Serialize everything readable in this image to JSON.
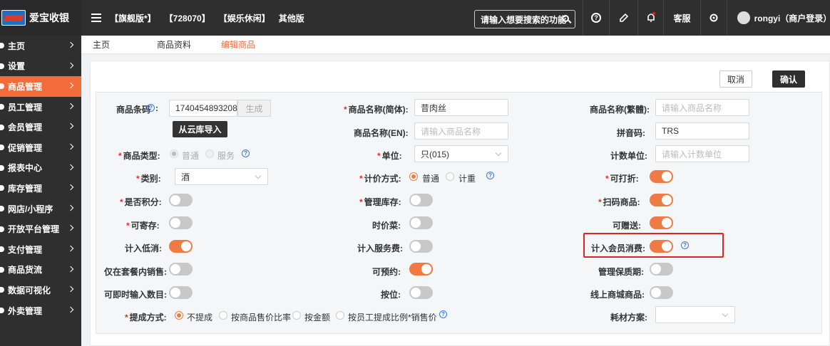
{
  "app": {
    "name": "爱宝收银"
  },
  "header": {
    "tags": [
      "【旗舰版*】",
      "【728070】",
      "【娱乐休闲】",
      "其他版"
    ],
    "search_placeholder": "请输入想要搜索的功能",
    "message_label": "客服",
    "user_label": "rongyi（商户登录）"
  },
  "sidebar": {
    "items": [
      {
        "label": "主页"
      },
      {
        "label": "设置"
      },
      {
        "label": "商品管理"
      },
      {
        "label": "员工管理"
      },
      {
        "label": "会员管理"
      },
      {
        "label": "促销管理"
      },
      {
        "label": "报表中心"
      },
      {
        "label": "库存管理"
      },
      {
        "label": "网店/小程序"
      },
      {
        "label": "开放平台管理"
      },
      {
        "label": "支付管理"
      },
      {
        "label": "商品货流"
      },
      {
        "label": "数据可视化"
      },
      {
        "label": "外卖管理"
      }
    ],
    "active_index": 2
  },
  "tabs": [
    "主页",
    "商品资料",
    "编辑商品"
  ],
  "actions": {
    "cancel": "取消",
    "confirm": "确认"
  },
  "form": {
    "barcode": {
      "label": "商品条码",
      "value": "1740454893208",
      "generate": "生成",
      "import": "从云库导入"
    },
    "name_simplified": {
      "label": "商品名称(简体):",
      "value": "昔肉丝"
    },
    "name_traditional": {
      "label": "商品名称(繁體):",
      "placeholder": "请输入商品名称"
    },
    "name_en": {
      "label": "商品名称(EN):",
      "placeholder": "请输入商品名称"
    },
    "pinyin": {
      "label": "拼音码:",
      "value": "TRS"
    },
    "product_type": {
      "label": "商品类型:",
      "options": [
        "普通",
        "服务"
      ]
    },
    "unit": {
      "label": "单位:",
      "value": "只(015)"
    },
    "count_unit": {
      "label": "计数单位:",
      "placeholder": "请输入计数单位"
    },
    "category": {
      "label": "类别:",
      "value": "酒"
    },
    "pricing": {
      "label": "计价方式:",
      "options": [
        "普通",
        "计重"
      ]
    },
    "discountable": {
      "label": "可打折:",
      "on": true
    },
    "points": {
      "label": "是否积分:",
      "on": false
    },
    "manage_stock": {
      "label": "管理库存:",
      "on": false
    },
    "scan": {
      "label": "扫码商品:",
      "on": true
    },
    "storable": {
      "label": "可寄存:",
      "on": false
    },
    "seasonal": {
      "label": "时价菜:",
      "on": false
    },
    "giftable": {
      "label": "可赠送:",
      "on": true
    },
    "min_spend": {
      "label": "计入低消:",
      "on": true
    },
    "service_fee": {
      "label": "计入服务费:",
      "on": false
    },
    "member_spend": {
      "label": "计入会员消费:",
      "on": true
    },
    "package_only": {
      "label": "仅在套餐内销售:",
      "on": false
    },
    "reservable": {
      "label": "可预约:",
      "on": true
    },
    "shelf_life": {
      "label": "管理保质期:",
      "on": false
    },
    "instant_qty": {
      "label": "可即时输入数目:",
      "on": false
    },
    "seat": {
      "label": "按位:",
      "on": false
    },
    "online_mall": {
      "label": "线上商城商品:",
      "on": false
    },
    "commission": {
      "label": "提成方式:",
      "options": [
        "不提成",
        "按商品售价比率",
        "按金额",
        "按员工提成比例*销售价"
      ]
    },
    "material": {
      "label": "耗材方案:"
    }
  },
  "colors": {
    "accent": "#f26c3a",
    "dark": "#2f2f2f",
    "highlight": "#e02424"
  }
}
